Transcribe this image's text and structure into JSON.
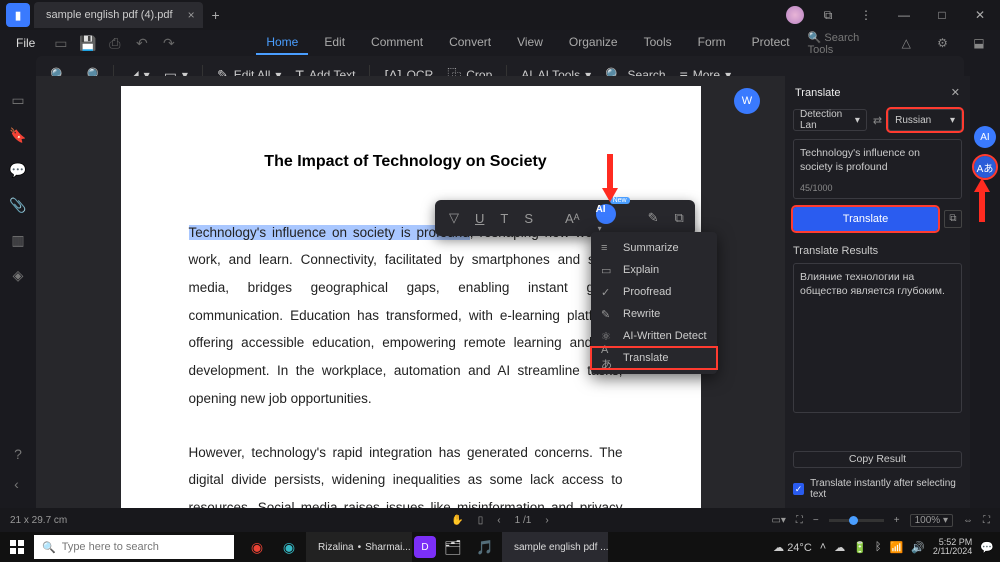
{
  "title_tab": "sample english pdf (4).pdf",
  "filemenu": "File",
  "menu": {
    "home": "Home",
    "edit": "Edit",
    "comment": "Comment",
    "convert": "Convert",
    "view": "View",
    "organize": "Organize",
    "tools": "Tools",
    "form": "Form",
    "protect": "Protect"
  },
  "search_tools_placeholder": "Search Tools",
  "toolbar": {
    "edit_all": "Edit All",
    "add_text": "Add Text",
    "ocr": "OCR",
    "crop": "Crop",
    "ai_tools": "AI Tools",
    "search": "Search",
    "more": "More"
  },
  "doc": {
    "heading": "The Impact of Technology on Society",
    "highlight": "Technology's influence on society is profound",
    "para1_rest": ", reshaping how we live, work, and learn. Connectivity, facilitated by smartphones and social media, bridges geographical gaps, enabling instant global communication. Education has transformed, with e-learning platforms offering accessible education, empowering remote learning and skill development. In the workplace, automation and AI streamline tasks, opening new job opportunities.",
    "para2": "However, technology's rapid integration has generated concerns. The digital divide persists, widening inequalities as some lack access to resources. Social media raises issues like misinformation and privacy concerns, necessitating"
  },
  "aimenu": {
    "summarize": "Summarize",
    "explain": "Explain",
    "proofread": "Proofread",
    "rewrite": "Rewrite",
    "detect": "AI-Written Detect",
    "translate": "Translate"
  },
  "float_new": "New",
  "panel": {
    "title": "Translate",
    "lang_from": "Detection Lan",
    "lang_to": "Russian",
    "input_text": "Technology's influence on society is profound",
    "char_count": "45/1000",
    "translate_btn": "Translate",
    "results_label": "Translate Results",
    "result_text": "Влияние технологии на общество является глубоким.",
    "copy_result": "Copy Result",
    "checkbox": "Translate instantly after selecting text"
  },
  "status": {
    "dim": "21 x 29.7 cm",
    "page": "1 /1",
    "zoom": "100%"
  },
  "taskbar": {
    "search_placeholder": "Type here to search",
    "app1": "Rizalina",
    "app1b": "Sharmai...",
    "app2": "sample english pdf ...",
    "weather": "24°C",
    "time": "5:52 PM",
    "date": "2/11/2024"
  }
}
